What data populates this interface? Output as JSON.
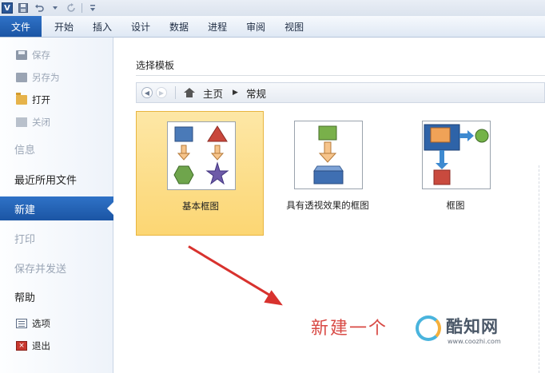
{
  "titlebar": {
    "app_letter": "V",
    "icons": [
      "save-icon",
      "undo-icon",
      "dropdown-icon",
      "redo-icon",
      "customize-icon"
    ]
  },
  "ribbon": {
    "file_tab": "文件",
    "tabs": [
      "开始",
      "插入",
      "设计",
      "数据",
      "进程",
      "审阅",
      "视图"
    ]
  },
  "backstage_menu": {
    "save": "保存",
    "save_as": "另存为",
    "open": "打开",
    "close": "关闭",
    "info": "信息",
    "recent": "最近所用文件",
    "new": "新建",
    "print": "打印",
    "save_send": "保存并发送",
    "help": "帮助",
    "options": "选项",
    "exit": "退出"
  },
  "main": {
    "section_title": "选择模板",
    "breadcrumb": [
      "主页",
      "常规"
    ],
    "templates": [
      {
        "label": "基本框图",
        "selected": true
      },
      {
        "label": "具有透视效果的框图",
        "selected": false
      },
      {
        "label": "框图",
        "selected": false
      }
    ]
  },
  "annotation": {
    "text": "新建一个"
  },
  "watermark": {
    "name": "酷知网",
    "url": "www.coozhi.com"
  },
  "colors": {
    "accent_blue": "#2f72c7",
    "selected_tile": "#fcd673",
    "annotation_red": "#d84a45"
  }
}
